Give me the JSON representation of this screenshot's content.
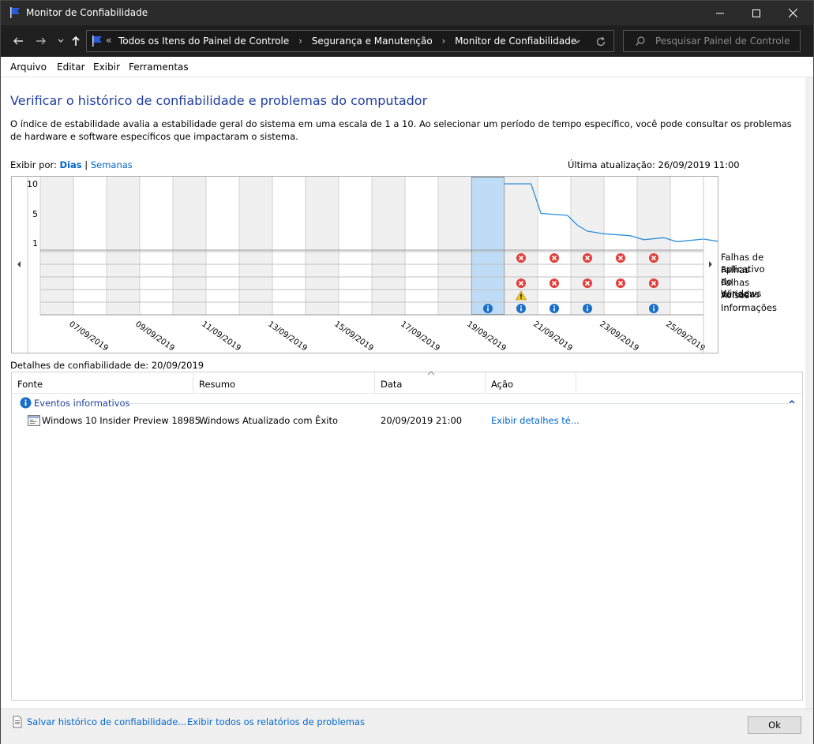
{
  "window": {
    "title": "Monitor de Confiabilidade"
  },
  "address": {
    "crumbs": [
      "Todos os Itens do Painel de Controle",
      "Segurança e Manutenção",
      "Monitor de Confiabilidade"
    ],
    "search_placeholder": "Pesquisar Painel de Controle"
  },
  "menu": [
    "Arquivo",
    "Editar",
    "Exibir",
    "Ferramentas"
  ],
  "page": {
    "heading": "Verificar o histórico de confiabilidade e problemas do computador",
    "description": "O índice de estabilidade avalia a estabilidade geral do sistema em uma escala de 1 a 10. Ao selecionar um período de tempo específico, você pode consultar os problemas de hardware e software específicos que impactaram o sistema.",
    "view_by_label": "Exibir por:",
    "view_days": "Dias",
    "view_sep": "|",
    "view_weeks": "Semanas",
    "last_update": "Última atualização: 26/09/2019 11:00"
  },
  "chart_data": {
    "type": "line",
    "y_ticks": [
      "10",
      "5",
      "1"
    ],
    "ylim": [
      1,
      10
    ],
    "dates": [
      "07/09/2019",
      "09/09/2019",
      "11/09/2019",
      "13/09/2019",
      "15/09/2019",
      "17/09/2019",
      "19/09/2019",
      "21/09/2019",
      "23/09/2019",
      "25/09/2019"
    ],
    "columns": 20,
    "first_day": "06/09/2019",
    "selected_column": 13,
    "stability_index": [
      [
        14,
        10
      ],
      [
        14.8,
        10
      ],
      [
        15.1,
        5.5
      ],
      [
        15.9,
        5.2
      ],
      [
        16.2,
        3.7
      ],
      [
        16.5,
        2.8
      ],
      [
        17,
        2.4
      ],
      [
        17.8,
        2.1
      ],
      [
        18.2,
        1.5
      ],
      [
        18.8,
        1.8
      ],
      [
        19.2,
        1.2
      ],
      [
        20,
        1.6
      ],
      [
        20.5,
        1.2
      ],
      [
        21.2,
        1.5
      ]
    ],
    "events": {
      "app_failures": [
        14,
        15,
        16,
        17,
        18
      ],
      "windows_failures": [],
      "misc_failures": [
        14,
        15,
        16,
        17,
        18
      ],
      "warnings": [
        14
      ],
      "information": [
        13,
        14,
        15,
        16,
        18
      ]
    },
    "legend": [
      "Falhas de aplicativo",
      "Falhas do Windows",
      "Falhas variadas",
      "Avisos",
      "Informações"
    ]
  },
  "details": {
    "label": "Detalhes de confiabilidade de: 20/09/2019",
    "columns": [
      "Fonte",
      "Resumo",
      "Data",
      "Ação"
    ],
    "group": "Eventos informativos",
    "rows": [
      {
        "source": "Windows 10 Insider Preview 18985...",
        "summary": "Windows Atualizado com Êxito",
        "date": "20/09/2019 21:00",
        "action": "Exibir detalhes té..."
      }
    ]
  },
  "footer": {
    "save_link": "Salvar histórico de confiabilidade...",
    "reports_link": "Exibir todos os relatórios de problemas",
    "ok": "Ok"
  }
}
